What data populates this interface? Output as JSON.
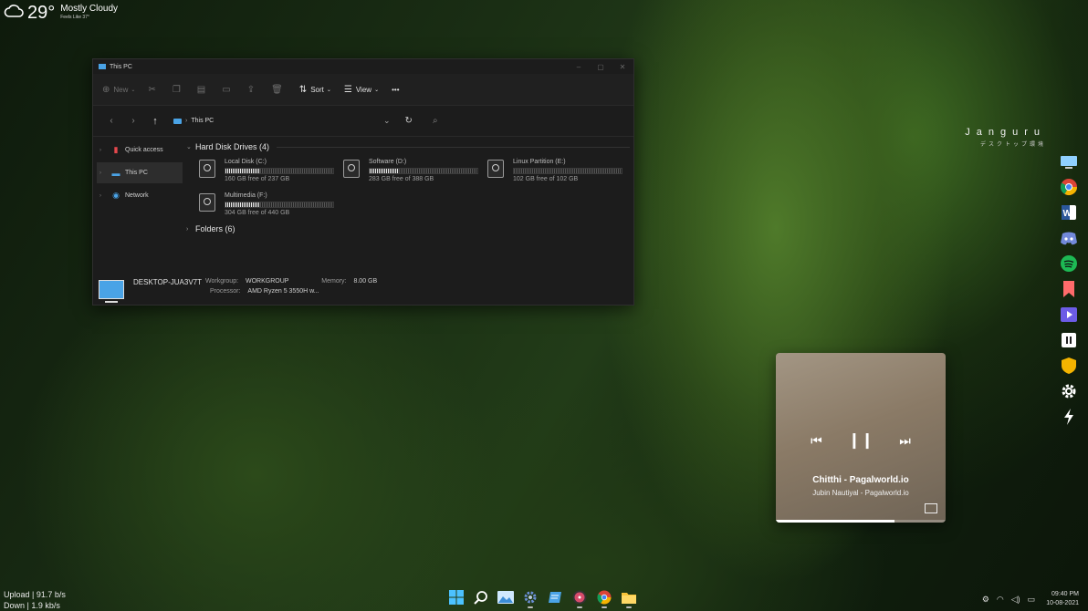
{
  "weather": {
    "temp": "29°",
    "condition": "Mostly Cloudy",
    "feels_like": "Feels Like 37°"
  },
  "explorer": {
    "title": "This PC",
    "toolbar": {
      "new": "New",
      "sort": "Sort",
      "view": "View",
      "more": "•••"
    },
    "address": {
      "crumb": "This PC"
    },
    "sidebar": [
      {
        "label": "Quick access",
        "icon": "bookmark-icon",
        "color": "#e5484d"
      },
      {
        "label": "This PC",
        "icon": "computer-icon",
        "color": "#4aa3e6"
      },
      {
        "label": "Network",
        "icon": "globe-icon",
        "color": "#4aa3e6"
      }
    ],
    "hdd_group": "Hard Disk Drives (4)",
    "drives": [
      {
        "name": "Local Disk (C:)",
        "free": "160 GB free of 237 GB",
        "used_fraction": 0.32
      },
      {
        "name": "Software (D:)",
        "free": "283 GB free of 388 GB",
        "used_fraction": 0.27
      },
      {
        "name": "Linux Partition (E:)",
        "free": "102 GB free of 102 GB",
        "used_fraction": 0.0
      },
      {
        "name": "Multimedia (F:)",
        "free": "304 GB free of 440 GB",
        "used_fraction": 0.31
      }
    ],
    "folders_group": "Folders (6)",
    "details": {
      "hostname": "DESKTOP-JUA3V7T",
      "workgroup_label": "Workgroup:",
      "workgroup": "WORKGROUP",
      "memory_label": "Memory:",
      "memory": "8.00 GB",
      "processor_label": "Processor:",
      "processor": "AMD Ryzen 5 3550H w..."
    }
  },
  "brand": {
    "name": "Janguru",
    "subtitle": "デスクトップ環境"
  },
  "dock": [
    "monitor-icon",
    "chrome-icon",
    "word-icon",
    "discord-icon",
    "spotify-icon",
    "bookmark-icon",
    "video-icon",
    "pause-app-icon",
    "shield-icon",
    "settings-icon",
    "lightning-icon"
  ],
  "player": {
    "title": "Chitthi - Pagalworld.io",
    "artist": "Jubin Nautiyal - Pagalworld.io",
    "progress": 0.7
  },
  "network": {
    "up_label": "Upload",
    "up_value": "91.7 b/s",
    "down_label": "Down",
    "down_value": "1.9 kb/s"
  },
  "clock": {
    "time": "09:40 PM",
    "date": "10-08-2021"
  },
  "colors": {
    "accent": "#4aa3e6",
    "window_bg": "#1c1c1c"
  }
}
